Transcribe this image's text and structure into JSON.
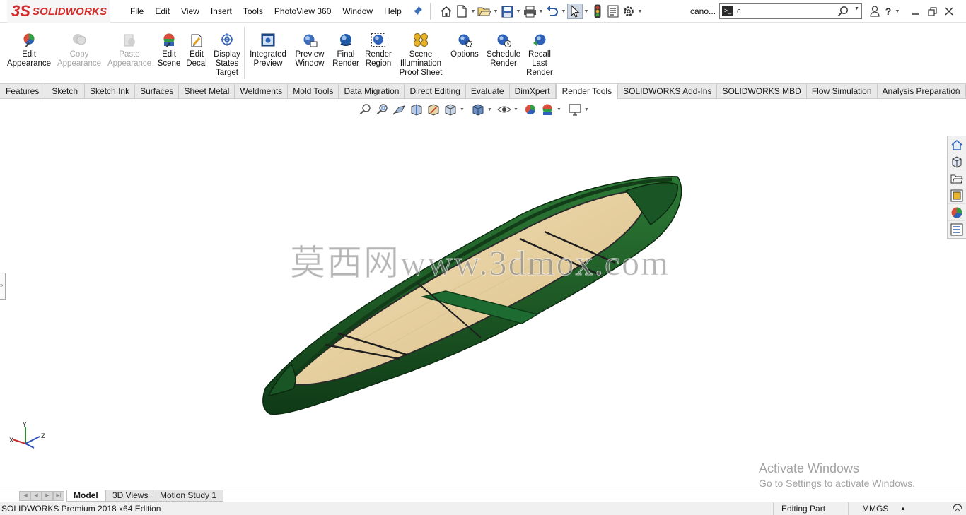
{
  "app": {
    "logo_prefix": "3S",
    "logo_text": "SOLIDWORKS",
    "document_name": "cano...",
    "accent_color": "#d52b2b"
  },
  "menu": [
    "File",
    "Edit",
    "View",
    "Insert",
    "Tools",
    "PhotoView 360",
    "Window",
    "Help"
  ],
  "search": {
    "value": "c",
    "command_icon": "command-prompt-icon",
    "search_icon": "magnifier-icon"
  },
  "quick_access": [
    "home-icon",
    "new-document-icon",
    "open-folder-icon",
    "save-icon",
    "print-icon",
    "undo-icon",
    "select-arrow-icon",
    "rebuild-traffic-light-icon",
    "file-properties-icon",
    "options-gear-icon"
  ],
  "ribbon": [
    {
      "label": [
        "Edit",
        "Appearance"
      ],
      "enabled": true,
      "icon": "edit-appearance-icon"
    },
    {
      "label": [
        "Copy",
        "Appearance"
      ],
      "enabled": false,
      "icon": "copy-appearance-icon"
    },
    {
      "label": [
        "Paste",
        "Appearance"
      ],
      "enabled": false,
      "icon": "paste-appearance-icon"
    },
    {
      "label": [
        "Edit",
        "Scene"
      ],
      "enabled": true,
      "icon": "edit-scene-icon"
    },
    {
      "label": [
        "Edit",
        "Decal"
      ],
      "enabled": true,
      "icon": "edit-decal-icon"
    },
    {
      "label": [
        "Display",
        "States",
        "Target"
      ],
      "enabled": true,
      "icon": "display-states-target-icon"
    },
    {
      "label": [
        "Integrated",
        "Preview"
      ],
      "enabled": true,
      "icon": "integrated-preview-icon"
    },
    {
      "label": [
        "Preview",
        "Window"
      ],
      "enabled": true,
      "icon": "preview-window-icon"
    },
    {
      "label": [
        "Final",
        "Render"
      ],
      "enabled": true,
      "icon": "final-render-icon"
    },
    {
      "label": [
        "Render",
        "Region"
      ],
      "enabled": true,
      "icon": "render-region-icon"
    },
    {
      "label": [
        "Scene",
        "Illumination",
        "Proof Sheet"
      ],
      "enabled": true,
      "icon": "scene-illumination-icon"
    },
    {
      "label": [
        "Options"
      ],
      "enabled": true,
      "icon": "options-icon"
    },
    {
      "label": [
        "Schedule",
        "Render"
      ],
      "enabled": true,
      "icon": "schedule-render-icon"
    },
    {
      "label": [
        "Recall",
        "Last",
        "Render"
      ],
      "enabled": true,
      "icon": "recall-last-render-icon"
    }
  ],
  "tabs": [
    "Features",
    "Sketch",
    "Sketch Ink",
    "Surfaces",
    "Sheet Metal",
    "Weldments",
    "Mold Tools",
    "Data Migration",
    "Direct Editing",
    "Evaluate",
    "DimXpert",
    "Render Tools",
    "SOLIDWORKS Add-Ins",
    "SOLIDWORKS MBD",
    "Flow Simulation",
    "Analysis Preparation"
  ],
  "active_tab": "Render Tools",
  "heads_up_toolbar": [
    "zoom-to-fit-icon",
    "zoom-to-area-icon",
    "previous-view-icon",
    "section-view-icon",
    "dynamic-annotation-icon",
    "view-orientation-icon",
    "display-style-icon",
    "hide-show-items-icon",
    "edit-appearance-icon",
    "apply-scene-icon",
    "view-settings-icon"
  ],
  "task_pane": [
    "solidworks-resources-icon",
    "design-library-icon",
    "file-explorer-icon",
    "view-palette-icon",
    "appearances-scenes-icon",
    "custom-properties-icon"
  ],
  "model": {
    "description": "green canoe with wooden interior",
    "hull_color": "#1d5a28",
    "wood_color": "#e8d3a8",
    "thwart_color": "#1e6b31"
  },
  "watermark": "莫西网www.3dmox.com",
  "triad": {
    "x": "X",
    "y": "Y",
    "z": "Z"
  },
  "activation": {
    "title": "Activate Windows",
    "subtitle": "Go to Settings to activate Windows."
  },
  "bottom_tabs": [
    "Model",
    "3D Views",
    "Motion Study 1"
  ],
  "active_bottom_tab": "Model",
  "status": {
    "product": "SOLIDWORKS Premium 2018 x64 Edition",
    "mode": "Editing Part",
    "units": "MMGS"
  }
}
